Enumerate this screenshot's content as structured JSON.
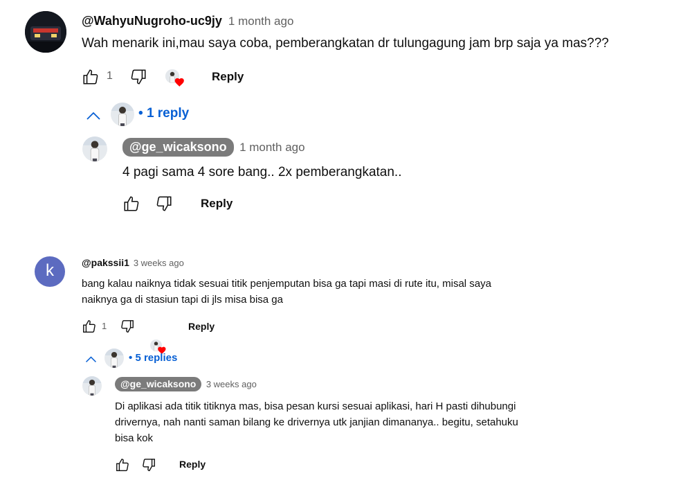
{
  "comments": [
    {
      "author": "@WahyuNugroho-uc9jy",
      "time": "1 month ago",
      "text": "Wah menarik ini,mau saya coba,  pemberangkatan dr tulungagung jam brp saja ya mas???",
      "likes": "1",
      "reply_label": "Reply",
      "replies_toggle": "1 reply",
      "reply": {
        "author": "@ge_wicaksono",
        "time": "1 month ago",
        "text": "4 pagi sama 4 sore bang.. 2x pemberangkatan..",
        "reply_label": "Reply"
      }
    },
    {
      "avatar_letter": "k",
      "author": "@pakssii1",
      "time": "3 weeks ago",
      "text_line1": "bang kalau naiknya tidak sesuai titik penjemputan bisa ga tapi masi di rute itu, misal saya",
      "text_line2": "naiknya ga di stasiun tapi di jls misa bisa ga",
      "likes": "1",
      "reply_label": "Reply",
      "replies_toggle": "5 replies",
      "reply": {
        "author": "@ge_wicaksono",
        "time": "3 weeks ago",
        "text_line1": "Di aplikasi ada titik titiknya mas, bisa pesan kursi sesuai aplikasi, hari H pasti dihubungi",
        "text_line2": "drivernya, nah nanti saman bilang ke drivernya utk janjian dimananya.. begitu, setahuku",
        "text_line3": "bisa kok",
        "reply_label": "Reply"
      }
    }
  ],
  "colors": {
    "link_blue": "#065fd4",
    "heart_red": "#ff0000",
    "avatar_purple": "#5c6bc0",
    "pill_gray": "#7b7b7b"
  },
  "icons": [
    "thumbs-up-icon",
    "thumbs-down-icon",
    "creator-heart-icon",
    "chevron-up-icon"
  ]
}
